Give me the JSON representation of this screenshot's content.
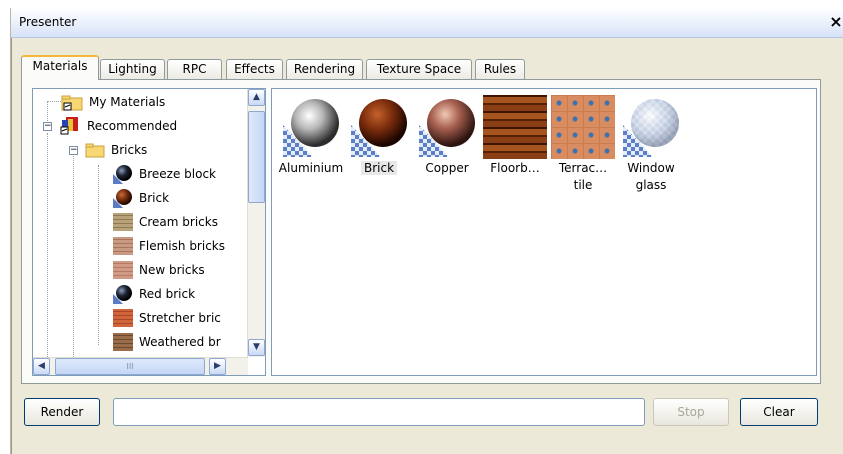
{
  "window": {
    "title": "Presenter",
    "close_glyph": "×"
  },
  "tabs": [
    {
      "label": "Materials",
      "active": true
    },
    {
      "label": "Lighting"
    },
    {
      "label": "RPC"
    },
    {
      "label": "Effects"
    },
    {
      "label": "Rendering"
    },
    {
      "label": "Texture Space"
    },
    {
      "label": "Rules"
    }
  ],
  "tree": {
    "my_materials": "My Materials",
    "recommended": "Recommended",
    "bricks": "Bricks",
    "items": [
      {
        "label": "Breeze block",
        "icon": "dark-sphere-icon"
      },
      {
        "label": "Brick",
        "icon": "brick-sphere-icon"
      },
      {
        "label": "Cream bricks",
        "icon": "cream-brick-texture-icon"
      },
      {
        "label": "Flemish bricks",
        "icon": "flemish-brick-texture-icon"
      },
      {
        "label": "New bricks",
        "icon": "new-brick-texture-icon"
      },
      {
        "label": "Red brick",
        "icon": "dark-sphere-icon"
      },
      {
        "label": "Stretcher bric",
        "icon": "stretcher-brick-texture-icon"
      },
      {
        "label": "Weathered br",
        "icon": "weathered-brick-texture-icon"
      }
    ],
    "hscroll_grip": "III"
  },
  "gallery": [
    {
      "label1": "Aluminium",
      "label2": ""
    },
    {
      "label1": "Brick",
      "label2": "",
      "selected": true
    },
    {
      "label1": "Copper",
      "label2": ""
    },
    {
      "label1": "Floorb…",
      "label2": ""
    },
    {
      "label1": "Terrac…",
      "label2": "tile"
    },
    {
      "label1": "Window",
      "label2": "glass"
    }
  ],
  "buttons": {
    "render": "Render",
    "stop": "Stop",
    "clear": "Clear"
  },
  "status_value": ""
}
